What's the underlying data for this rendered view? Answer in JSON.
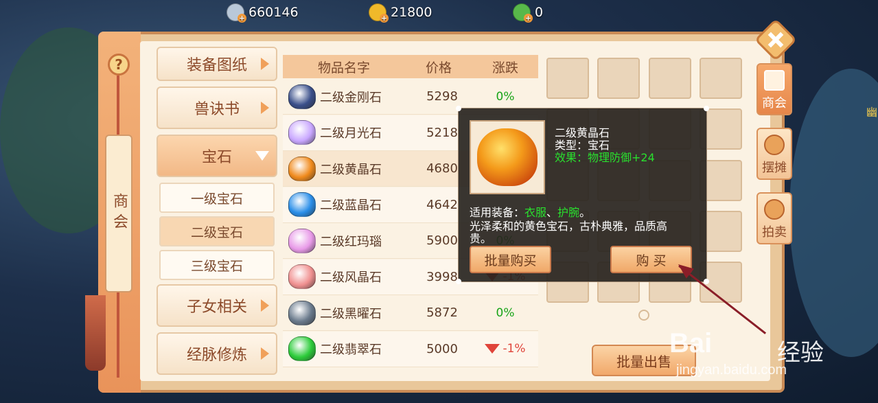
{
  "currency": {
    "silver": "660146",
    "gold": "21800",
    "jade": "0",
    "colors": {
      "silver": "#b9c8d9",
      "gold": "#f0b92a",
      "jade": "#58b84a"
    }
  },
  "side_title": "商会",
  "help_label": "?",
  "categories": {
    "items": [
      {
        "label": "装备图纸"
      },
      {
        "label": "兽诀书"
      },
      {
        "label": "宝石"
      },
      {
        "label": "子女相关"
      },
      {
        "label": "经脉修炼"
      }
    ],
    "active": "宝石",
    "sub_items": [
      {
        "label": "一级宝石"
      },
      {
        "label": "二级宝石"
      },
      {
        "label": "三级宝石"
      }
    ],
    "active_sub": "二级宝石"
  },
  "table": {
    "headers": [
      "物品名字",
      "价格",
      "涨跌"
    ],
    "rows": [
      {
        "name": "二级金刚石",
        "price": "5298",
        "change": "0%",
        "trend": "flat",
        "gem_color": "#3a4f8a"
      },
      {
        "name": "二级月光石",
        "price": "5218",
        "change": "",
        "trend": "flat",
        "gem_color": "#c9a7ff"
      },
      {
        "name": "二级黄晶石",
        "price": "4680",
        "change": "",
        "trend": "flat",
        "gem_color": "#f08a1c"
      },
      {
        "name": "二级蓝晶石",
        "price": "4642",
        "change": "",
        "trend": "flat",
        "gem_color": "#2a8ee8"
      },
      {
        "name": "二级红玛瑙",
        "price": "5900",
        "change": "0%",
        "trend": "flat",
        "gem_color": "#e89ae8"
      },
      {
        "name": "二级风晶石",
        "price": "3998",
        "change": "-1%",
        "trend": "down",
        "gem_color": "#f09090"
      },
      {
        "name": "二级黑曜石",
        "price": "5872",
        "change": "0%",
        "trend": "flat",
        "gem_color": "#6a7a8c"
      },
      {
        "name": "二级翡翠石",
        "price": "5000",
        "change": "-1%",
        "trend": "down",
        "gem_color": "#2ccc3a"
      }
    ]
  },
  "tooltip": {
    "title": "二级黄晶石",
    "type_line": "类型：宝石",
    "effect_line": "效果：物理防御+24",
    "equip_prefix": "适用装备：",
    "equip_item1": "衣服",
    "equip_sep": "、",
    "equip_item2": "护腕",
    "equip_end": "。",
    "desc_line1": "光泽柔和的黄色宝石，古朴典雅，品质高",
    "desc_line2": "贵。",
    "bulk_buy_label": "批量购买",
    "buy_label": "购 买"
  },
  "bulk_sell_label": "批量出售",
  "right_tabs": [
    {
      "label": "商会",
      "active": true
    },
    {
      "label": "摆摊",
      "active": false
    },
    {
      "label": "拍卖",
      "active": false
    }
  ],
  "edge_text": "幽",
  "watermark": {
    "brand": "Bai",
    "brand_cn": "经验",
    "url": "jingyan.baidu.com"
  }
}
